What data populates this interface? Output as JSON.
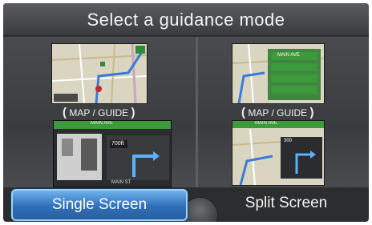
{
  "header": {
    "title": "Select a guidance mode"
  },
  "left_option": {
    "caption_open": "(",
    "caption": "MAP / GUIDE",
    "caption_close": ")",
    "guide_street_top": "MAIN AVE",
    "guide_street_bottom": "MAIN ST",
    "guide_distance": "700",
    "guide_unit": "ft"
  },
  "right_option": {
    "caption_open": "(",
    "caption": "MAP / GUIDE",
    "caption_close": ")",
    "list_items": [
      "MAIN AVE",
      "",
      "",
      ""
    ],
    "guide_street_top": "MAIN AVE",
    "guide_distance": "300"
  },
  "buttons": {
    "single": "Single Screen",
    "split": "Split Screen"
  },
  "colors": {
    "selected_button": "#2f6fb8",
    "frame": "#2c2d2f",
    "map_land": "#d7d3bf",
    "route": "#3a7bd5"
  }
}
